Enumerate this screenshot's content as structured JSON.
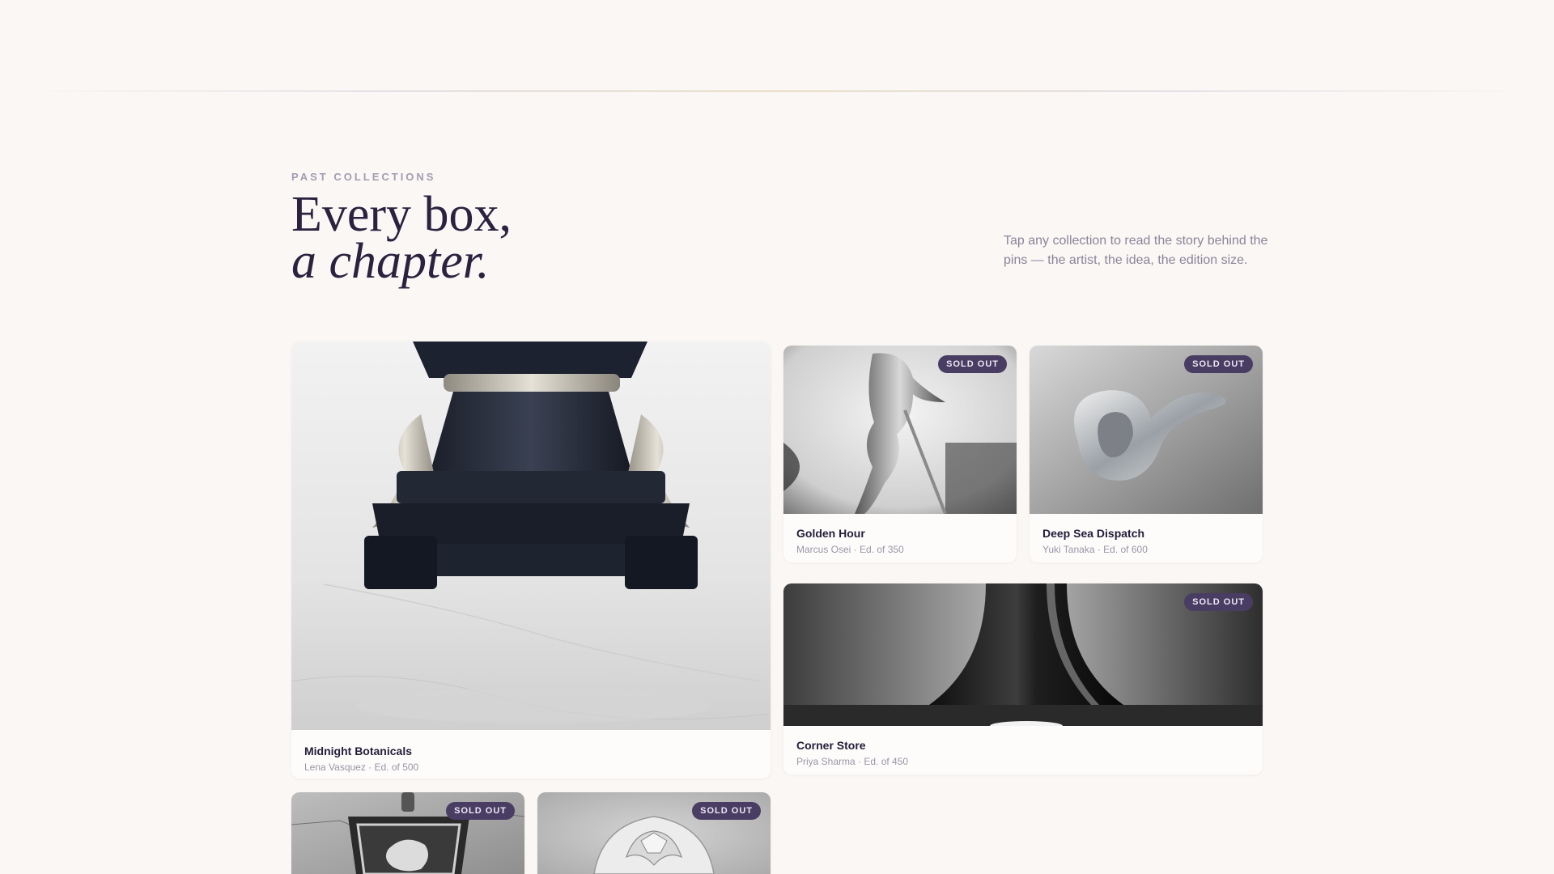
{
  "header": {
    "eyebrow": "PAST COLLECTIONS",
    "headline_line1": "Every box,",
    "headline_line2": "a chapter.",
    "intro": "Tap any collection to read the story behind the pins — the artist, the idea, the edition size."
  },
  "collections": [
    {
      "title": "Midnight Botanicals",
      "subtitle": "Lena Vasquez · Ed. of 500",
      "image": "black-and-silver-pedestal-on-marble"
    },
    {
      "title": "Golden Hour",
      "subtitle": "Marcus Osei · Ed. of 350",
      "badge": "SOLD OUT",
      "image": "silver-seahorse-pin"
    },
    {
      "title": "Deep Sea Dispatch",
      "subtitle": "Yuki Tanaka · Ed. of 600",
      "badge": "SOLD OUT",
      "image": "silver-loop-pin"
    },
    {
      "title": "Corner Store",
      "subtitle": "Priya Sharma · Ed. of 450",
      "badge": "SOLD OUT",
      "image": "black-glossy-vase-base"
    },
    {
      "badge": "SOLD OUT",
      "image": "lion-crest-shield-pendant"
    },
    {
      "badge": "SOLD OUT",
      "image": "silver-rose-pin"
    }
  ],
  "colors": {
    "background": "#faf7f4",
    "badge": "#4a3d63",
    "heading": "#2a2340",
    "muted": "#8b849a"
  }
}
